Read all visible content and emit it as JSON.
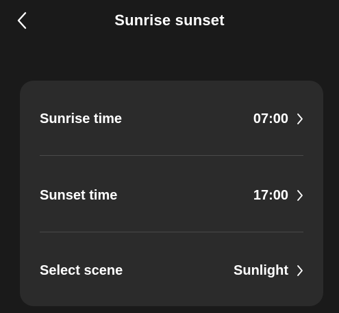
{
  "header": {
    "title": "Sunrise sunset",
    "back_icon": "chevron-left-icon"
  },
  "settings": {
    "rows": [
      {
        "label": "Sunrise time",
        "value": "07:00",
        "icon": "chevron-right-icon"
      },
      {
        "label": "Sunset time",
        "value": "17:00",
        "icon": "chevron-right-icon"
      },
      {
        "label": "Select scene",
        "value": "Sunlight",
        "icon": "chevron-right-icon"
      }
    ]
  },
  "colors": {
    "background": "#1a1a1a",
    "card": "#2b2b2b",
    "divider": "#4a4a4a",
    "text": "#ffffff"
  }
}
